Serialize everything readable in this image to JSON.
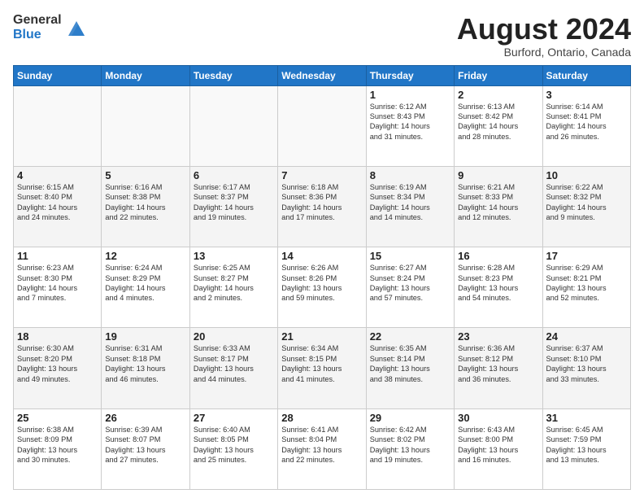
{
  "logo": {
    "general": "General",
    "blue": "Blue"
  },
  "title": "August 2024",
  "subtitle": "Burford, Ontario, Canada",
  "days_header": [
    "Sunday",
    "Monday",
    "Tuesday",
    "Wednesday",
    "Thursday",
    "Friday",
    "Saturday"
  ],
  "weeks": [
    [
      {
        "day": "",
        "info": ""
      },
      {
        "day": "",
        "info": ""
      },
      {
        "day": "",
        "info": ""
      },
      {
        "day": "",
        "info": ""
      },
      {
        "day": "1",
        "info": "Sunrise: 6:12 AM\nSunset: 8:43 PM\nDaylight: 14 hours\nand 31 minutes."
      },
      {
        "day": "2",
        "info": "Sunrise: 6:13 AM\nSunset: 8:42 PM\nDaylight: 14 hours\nand 28 minutes."
      },
      {
        "day": "3",
        "info": "Sunrise: 6:14 AM\nSunset: 8:41 PM\nDaylight: 14 hours\nand 26 minutes."
      }
    ],
    [
      {
        "day": "4",
        "info": "Sunrise: 6:15 AM\nSunset: 8:40 PM\nDaylight: 14 hours\nand 24 minutes."
      },
      {
        "day": "5",
        "info": "Sunrise: 6:16 AM\nSunset: 8:38 PM\nDaylight: 14 hours\nand 22 minutes."
      },
      {
        "day": "6",
        "info": "Sunrise: 6:17 AM\nSunset: 8:37 PM\nDaylight: 14 hours\nand 19 minutes."
      },
      {
        "day": "7",
        "info": "Sunrise: 6:18 AM\nSunset: 8:36 PM\nDaylight: 14 hours\nand 17 minutes."
      },
      {
        "day": "8",
        "info": "Sunrise: 6:19 AM\nSunset: 8:34 PM\nDaylight: 14 hours\nand 14 minutes."
      },
      {
        "day": "9",
        "info": "Sunrise: 6:21 AM\nSunset: 8:33 PM\nDaylight: 14 hours\nand 12 minutes."
      },
      {
        "day": "10",
        "info": "Sunrise: 6:22 AM\nSunset: 8:32 PM\nDaylight: 14 hours\nand 9 minutes."
      }
    ],
    [
      {
        "day": "11",
        "info": "Sunrise: 6:23 AM\nSunset: 8:30 PM\nDaylight: 14 hours\nand 7 minutes."
      },
      {
        "day": "12",
        "info": "Sunrise: 6:24 AM\nSunset: 8:29 PM\nDaylight: 14 hours\nand 4 minutes."
      },
      {
        "day": "13",
        "info": "Sunrise: 6:25 AM\nSunset: 8:27 PM\nDaylight: 14 hours\nand 2 minutes."
      },
      {
        "day": "14",
        "info": "Sunrise: 6:26 AM\nSunset: 8:26 PM\nDaylight: 13 hours\nand 59 minutes."
      },
      {
        "day": "15",
        "info": "Sunrise: 6:27 AM\nSunset: 8:24 PM\nDaylight: 13 hours\nand 57 minutes."
      },
      {
        "day": "16",
        "info": "Sunrise: 6:28 AM\nSunset: 8:23 PM\nDaylight: 13 hours\nand 54 minutes."
      },
      {
        "day": "17",
        "info": "Sunrise: 6:29 AM\nSunset: 8:21 PM\nDaylight: 13 hours\nand 52 minutes."
      }
    ],
    [
      {
        "day": "18",
        "info": "Sunrise: 6:30 AM\nSunset: 8:20 PM\nDaylight: 13 hours\nand 49 minutes."
      },
      {
        "day": "19",
        "info": "Sunrise: 6:31 AM\nSunset: 8:18 PM\nDaylight: 13 hours\nand 46 minutes."
      },
      {
        "day": "20",
        "info": "Sunrise: 6:33 AM\nSunset: 8:17 PM\nDaylight: 13 hours\nand 44 minutes."
      },
      {
        "day": "21",
        "info": "Sunrise: 6:34 AM\nSunset: 8:15 PM\nDaylight: 13 hours\nand 41 minutes."
      },
      {
        "day": "22",
        "info": "Sunrise: 6:35 AM\nSunset: 8:14 PM\nDaylight: 13 hours\nand 38 minutes."
      },
      {
        "day": "23",
        "info": "Sunrise: 6:36 AM\nSunset: 8:12 PM\nDaylight: 13 hours\nand 36 minutes."
      },
      {
        "day": "24",
        "info": "Sunrise: 6:37 AM\nSunset: 8:10 PM\nDaylight: 13 hours\nand 33 minutes."
      }
    ],
    [
      {
        "day": "25",
        "info": "Sunrise: 6:38 AM\nSunset: 8:09 PM\nDaylight: 13 hours\nand 30 minutes."
      },
      {
        "day": "26",
        "info": "Sunrise: 6:39 AM\nSunset: 8:07 PM\nDaylight: 13 hours\nand 27 minutes."
      },
      {
        "day": "27",
        "info": "Sunrise: 6:40 AM\nSunset: 8:05 PM\nDaylight: 13 hours\nand 25 minutes."
      },
      {
        "day": "28",
        "info": "Sunrise: 6:41 AM\nSunset: 8:04 PM\nDaylight: 13 hours\nand 22 minutes."
      },
      {
        "day": "29",
        "info": "Sunrise: 6:42 AM\nSunset: 8:02 PM\nDaylight: 13 hours\nand 19 minutes."
      },
      {
        "day": "30",
        "info": "Sunrise: 6:43 AM\nSunset: 8:00 PM\nDaylight: 13 hours\nand 16 minutes."
      },
      {
        "day": "31",
        "info": "Sunrise: 6:45 AM\nSunset: 7:59 PM\nDaylight: 13 hours\nand 13 minutes."
      }
    ]
  ]
}
